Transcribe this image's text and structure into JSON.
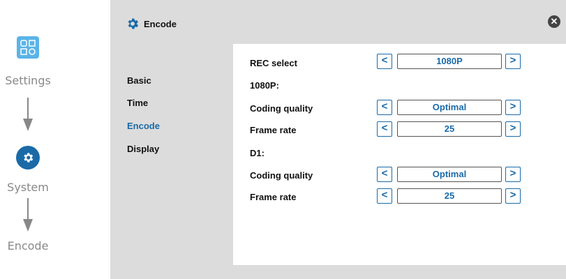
{
  "breadcrumb": {
    "items": [
      {
        "label": "Settings",
        "icon": "settings-grid-icon"
      },
      {
        "label": "System",
        "icon": "gear-icon"
      },
      {
        "label": "Encode"
      }
    ]
  },
  "dialog": {
    "title": "Encode",
    "close_icon": "close-icon"
  },
  "nav": {
    "items": [
      {
        "label": "Basic",
        "active": false
      },
      {
        "label": "Time",
        "active": false
      },
      {
        "label": "Encode",
        "active": true
      },
      {
        "label": "Display",
        "active": false
      }
    ]
  },
  "settings": {
    "rec_select": {
      "label": "REC select",
      "value": "1080P"
    },
    "section_1080p": "1080P:",
    "coding_quality_1080p": {
      "label": "Coding quality",
      "value": "Optimal"
    },
    "frame_rate_1080p": {
      "label": "Frame rate",
      "value": "25"
    },
    "section_d1": "D1:",
    "coding_quality_d1": {
      "label": "Coding quality",
      "value": "Optimal"
    },
    "frame_rate_d1": {
      "label": "Frame rate",
      "value": "25"
    }
  },
  "colors": {
    "accent": "#1a6aa8",
    "settings_icon_bg": "#5ab4e8",
    "panel_bg": "#dcdcdc"
  }
}
